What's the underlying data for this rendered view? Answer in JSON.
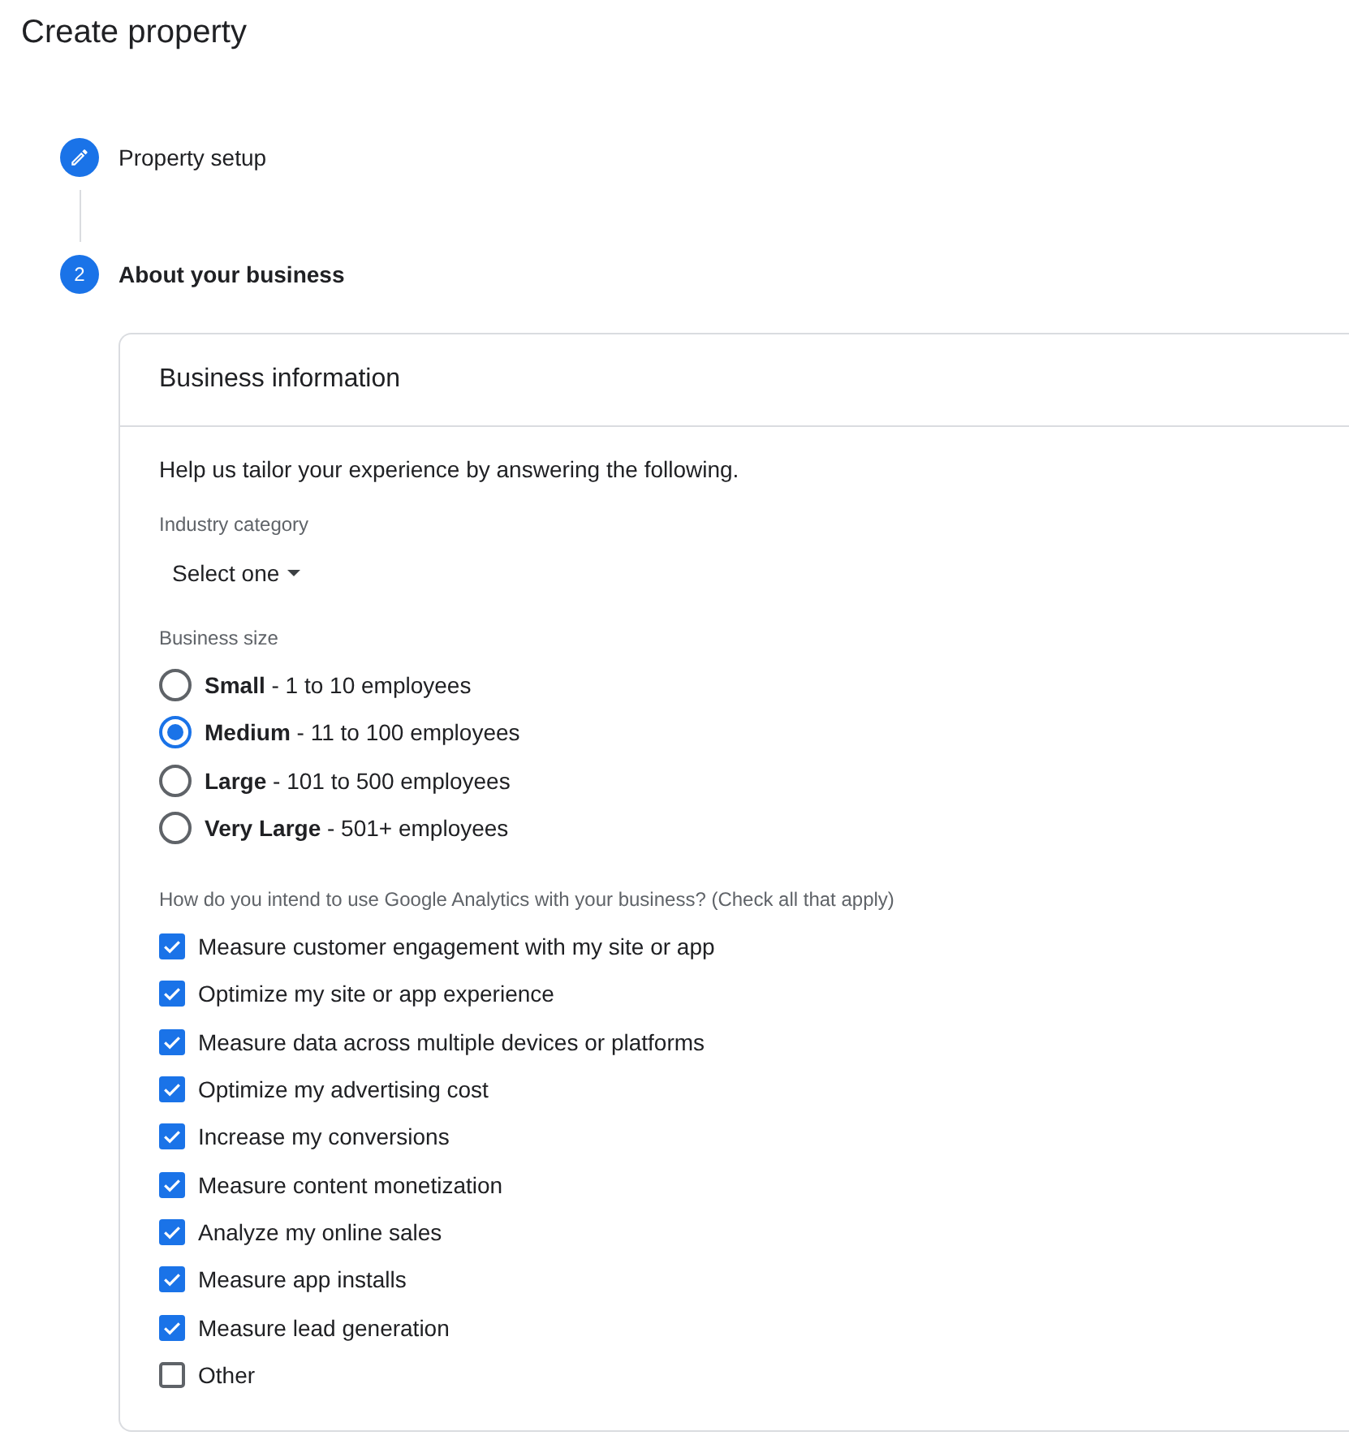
{
  "page": {
    "title": "Create property"
  },
  "steps": [
    {
      "kind": "edit",
      "label": "Property setup",
      "selected": false
    },
    {
      "kind": "number",
      "number": "2",
      "label": "About your business",
      "selected": true
    }
  ],
  "business_information": {
    "title": "Business information",
    "intro": "Help us tailor your experience by answering the following.",
    "industry_category": {
      "label": "Industry category",
      "value": "Select one"
    },
    "business_size": {
      "label": "Business size",
      "options": [
        {
          "label": "**Small** - 1 to 10 employees",
          "selected": false
        },
        {
          "label": "**Medium** - 11 to 100 employees",
          "selected": true
        },
        {
          "label": "**Large** - 101 to 500 employees",
          "selected": false
        },
        {
          "label": "**Very Large** - 501+ employees",
          "selected": false
        }
      ]
    },
    "intended_use": {
      "label": "How do you intend to use Google Analytics with your business? (Check all that apply)",
      "options": [
        {
          "label": "Measure customer engagement with my site or app",
          "checked": true
        },
        {
          "label": "Optimize my site or app experience",
          "checked": true
        },
        {
          "label": "Measure data across multiple devices or platforms",
          "checked": true
        },
        {
          "label": "Optimize my advertising cost",
          "checked": true
        },
        {
          "label": "Increase my conversions",
          "checked": true
        },
        {
          "label": "Measure content monetization",
          "checked": true
        },
        {
          "label": "Analyze my online sales",
          "checked": true
        },
        {
          "label": "Measure app installs",
          "checked": true
        },
        {
          "label": "Measure lead generation",
          "checked": true
        },
        {
          "label": "Other",
          "checked": false
        }
      ]
    }
  }
}
